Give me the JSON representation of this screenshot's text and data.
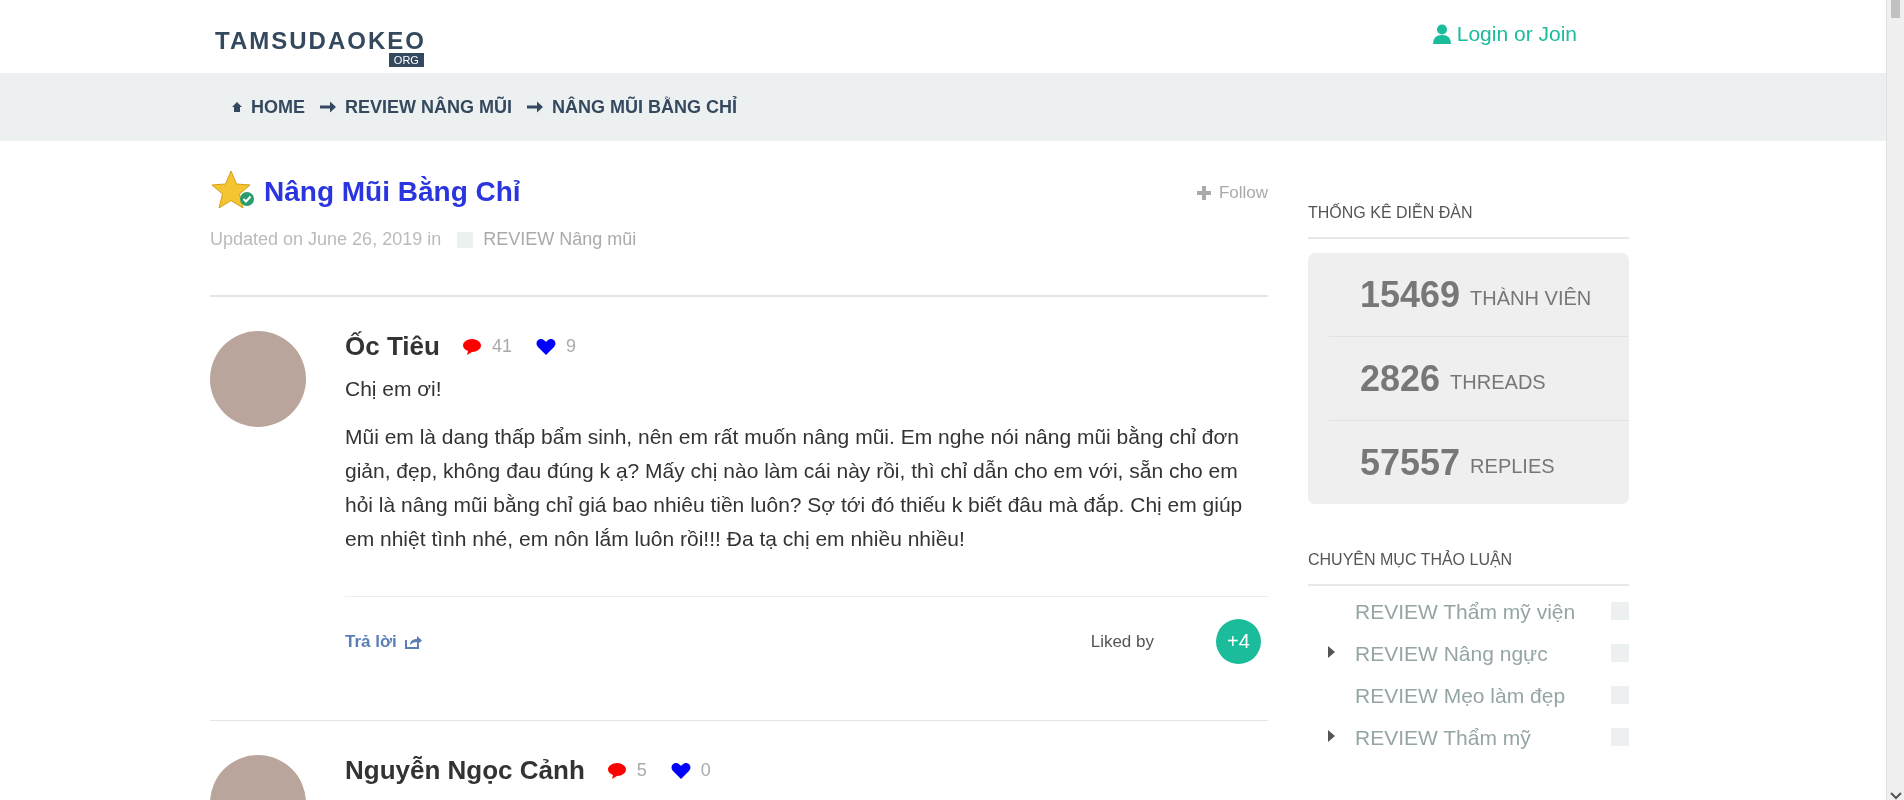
{
  "header": {
    "logo": "TAMSUDAOKEO",
    "logo_suffix": "ORG",
    "login": "Login or Join"
  },
  "breadcrumbs": [
    {
      "label": "HOME"
    },
    {
      "label": "REVIEW NÂNG MŨI"
    },
    {
      "label": "NÂNG MŨI BẰNG CHỈ"
    }
  ],
  "thread": {
    "title": "Nâng Mũi Bằng Chỉ",
    "follow": "Follow",
    "updated": "Updated on June 26, 2019 in",
    "category": "REVIEW Nâng mũi"
  },
  "posts": [
    {
      "kind": "text",
      "author": "Ốc Tiêu",
      "comments": "41",
      "likes": "9",
      "paragraphs": [
        "Chị em ơi!",
        "Mũi em là dang thấp bẩm sinh, nên em rất muốn nâng mũi. Em nghe nói nâng mũi bằng chỉ đơn giản, đẹp, không đau đúng k ạ? Mấy chị nào làm cái này rồi, thì chỉ dẫn cho em với, sẵn cho em hỏi là nâng mũi bằng chỉ giá bao nhiêu tiền luôn? Sợ tới đó thiếu k biết đâu mà đắp. Chị em giúp em nhiệt tình nhé, em nôn lắm luôn rồi!!! Đa tạ chị em nhiều nhiều!"
      ],
      "reply": "Trả lời",
      "liked_by": "Liked by",
      "liked_count": "+4"
    },
    {
      "kind": "quote",
      "author": "Nguyễn Ngọc Cảnh",
      "comments": "5",
      "likes": "0"
    }
  ],
  "sidebar": {
    "stats_title": "THỐNG KÊ DIỄN ĐÀN",
    "stats": [
      {
        "value": "15469",
        "label": "THÀNH VIÊN"
      },
      {
        "value": "2826",
        "label": "THREADS"
      },
      {
        "value": "57557",
        "label": "REPLIES"
      }
    ],
    "categories_title": "CHUYÊN MỤC THẢO LUẬN",
    "categories": [
      {
        "label": "REVIEW Thẩm mỹ viện",
        "collapsible": false
      },
      {
        "label": "REVIEW Nâng ngực",
        "collapsible": true
      },
      {
        "label": "REVIEW Mẹo làm đẹp",
        "collapsible": false
      },
      {
        "label": "REVIEW Thẩm mỹ",
        "collapsible": true
      }
    ]
  }
}
